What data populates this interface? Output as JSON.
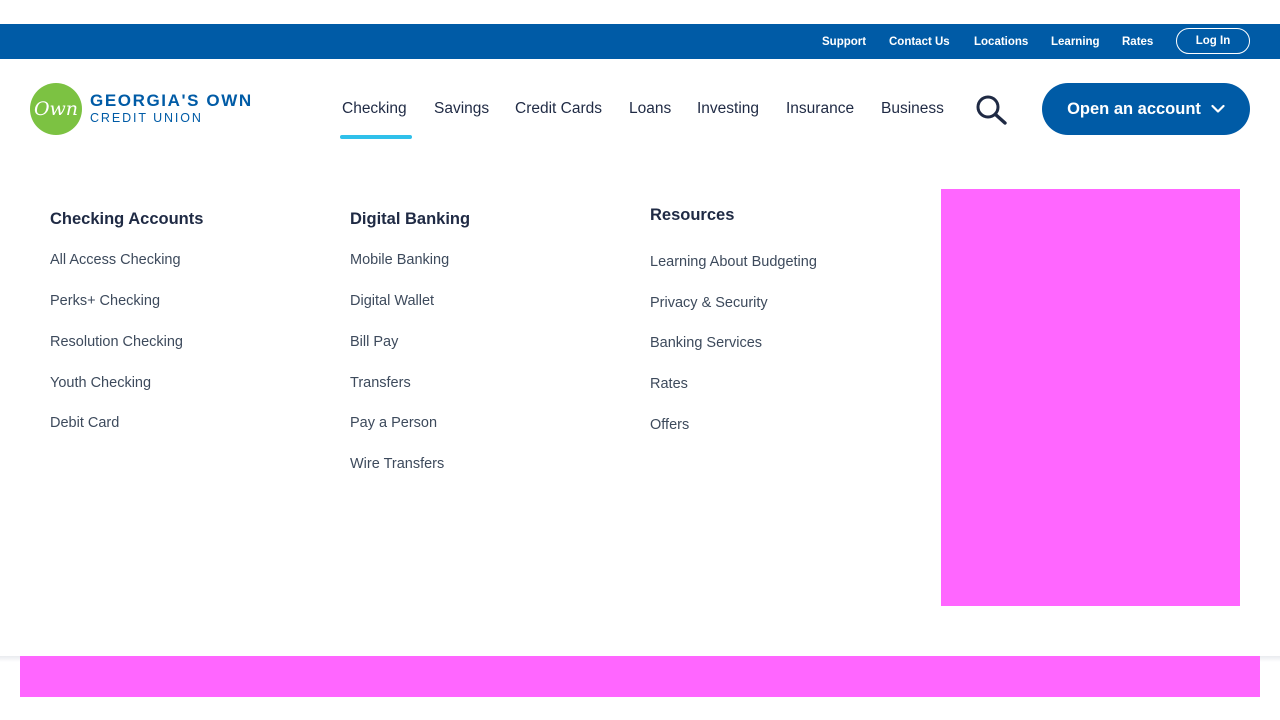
{
  "utility_nav": {
    "links": [
      "Support",
      "Contact Us",
      "Locations",
      "Learning",
      "Rates"
    ],
    "login_label": "Log In"
  },
  "logo": {
    "badge_text": "Own",
    "line1": "GEORGIA'S OWN",
    "line2": "CREDIT UNION",
    "badge_color": "#7cc242",
    "brand_color": "#005ba6"
  },
  "main_nav": {
    "items": [
      "Checking",
      "Savings",
      "Credit Cards",
      "Loans",
      "Investing",
      "Insurance",
      "Business"
    ],
    "active": "Checking",
    "search_icon": "search-icon",
    "open_account_label": "Open an account",
    "open_account_icon": "chevron-down-icon"
  },
  "mega_menu": {
    "columns": [
      {
        "heading": "Checking Accounts",
        "links": [
          "All Access Checking",
          "Perks+ Checking",
          "Resolution Checking",
          "Youth Checking",
          "Debit Card"
        ]
      },
      {
        "heading": "Digital Banking",
        "links": [
          "Mobile Banking",
          "Digital Wallet",
          "Bill Pay",
          "Transfers",
          "Pay a Person",
          "Wire Transfers"
        ]
      },
      {
        "heading": "Resources",
        "links": [
          "Learning About Budgeting",
          "Privacy & Security",
          "Banking Services",
          "Rates",
          "Offers"
        ]
      }
    ],
    "promo_color": "#ff66ff"
  },
  "colors": {
    "utility_bar": "#005ba6",
    "active_underline": "#2fc0ea",
    "text_dark": "#1f2a44"
  }
}
